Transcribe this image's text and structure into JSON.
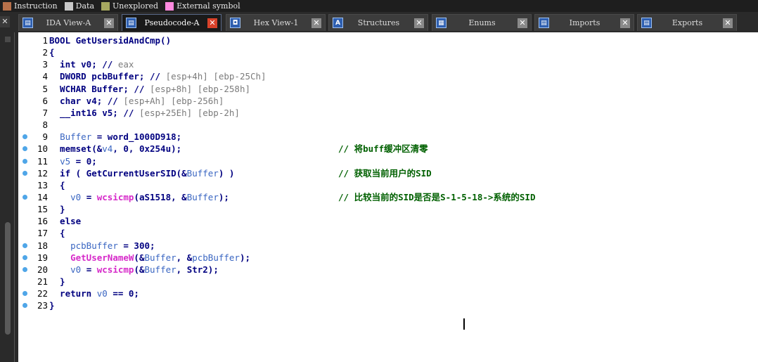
{
  "legend": [
    {
      "label": "Instruction",
      "color": "#b8714a"
    },
    {
      "label": "Data",
      "color": "#c8c8c8"
    },
    {
      "label": "Unexplored",
      "color": "#a7a860"
    },
    {
      "label": "External symbol",
      "color": "#ff8adf"
    }
  ],
  "tabs": [
    {
      "label": "IDA View-A",
      "icon": "ida-view-icon",
      "active": false
    },
    {
      "label": "Pseudocode-A",
      "icon": "pseudocode-icon",
      "active": true
    },
    {
      "label": "Hex View-1",
      "icon": "hex-view-icon",
      "active": false
    },
    {
      "label": "Structures",
      "icon": "structures-icon",
      "active": false
    },
    {
      "label": "Enums",
      "icon": "enums-icon",
      "active": false
    },
    {
      "label": "Imports",
      "icon": "imports-icon",
      "active": false
    },
    {
      "label": "Exports",
      "icon": "exports-icon",
      "active": false
    }
  ],
  "tab_close": "✕",
  "code": [
    {
      "n": "1",
      "bp": false,
      "text": "BOOL GetUsersidAndCmp()"
    },
    {
      "n": "2",
      "bp": false,
      "text": "{"
    },
    {
      "n": "3",
      "bp": false,
      "text": "  int v0; // eax"
    },
    {
      "n": "4",
      "bp": false,
      "text": "  DWORD pcbBuffer; // [esp+4h] [ebp-25Ch]"
    },
    {
      "n": "5",
      "bp": false,
      "text": "  WCHAR Buffer; // [esp+8h] [ebp-258h]"
    },
    {
      "n": "6",
      "bp": false,
      "text": "  char v4; // [esp+Ah] [ebp-256h]"
    },
    {
      "n": "7",
      "bp": false,
      "text": "  __int16 v5; // [esp+25Eh] [ebp-2h]"
    },
    {
      "n": "8",
      "bp": false,
      "text": ""
    },
    {
      "n": "9",
      "bp": true,
      "text": "  Buffer = word_1000D918;"
    },
    {
      "n": "10",
      "bp": true,
      "text": "  memset(&v4, 0, 0x254u);",
      "comment": "// 将buff缓冲区清零"
    },
    {
      "n": "11",
      "bp": true,
      "text": "  v5 = 0;"
    },
    {
      "n": "12",
      "bp": true,
      "text": "  if ( GetCurrentUserSID(&Buffer) )",
      "comment": "// 获取当前用户的SID"
    },
    {
      "n": "13",
      "bp": false,
      "text": "  {"
    },
    {
      "n": "14",
      "bp": true,
      "text": "    v0 = wcsicmp(aS1518, &Buffer);",
      "comment": "// 比较当前的SID是否是S-1-5-18->系统的SID"
    },
    {
      "n": "15",
      "bp": false,
      "text": "  }"
    },
    {
      "n": "16",
      "bp": false,
      "text": "  else"
    },
    {
      "n": "17",
      "bp": false,
      "text": "  {"
    },
    {
      "n": "18",
      "bp": true,
      "text": "    pcbBuffer = 300;"
    },
    {
      "n": "19",
      "bp": true,
      "text": "    GetUserNameW(&Buffer, &pcbBuffer);"
    },
    {
      "n": "20",
      "bp": true,
      "text": "    v0 = wcsicmp(&Buffer, Str2);"
    },
    {
      "n": "21",
      "bp": false,
      "text": "  }"
    },
    {
      "n": "22",
      "bp": true,
      "text": "  return v0 == 0;"
    },
    {
      "n": "23",
      "bp": true,
      "text": "}"
    }
  ]
}
